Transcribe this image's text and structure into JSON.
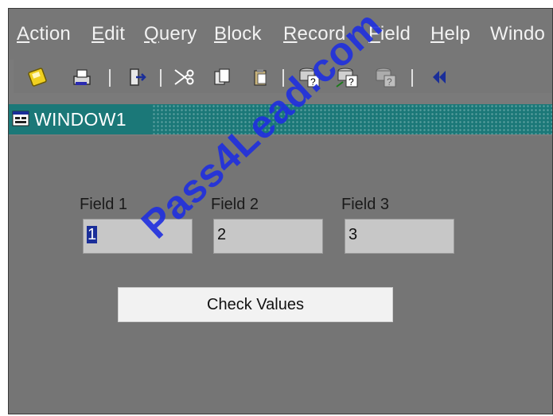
{
  "menu": {
    "items": [
      {
        "mnemonic": "A",
        "rest": "ction"
      },
      {
        "mnemonic": "E",
        "rest": "dit"
      },
      {
        "mnemonic": "Q",
        "rest": "uery"
      },
      {
        "mnemonic": "B",
        "rest": "lock"
      },
      {
        "mnemonic": "R",
        "rest": "ecord"
      },
      {
        "mnemonic": "F",
        "rest": "ield"
      },
      {
        "mnemonic": "H",
        "rest": "elp"
      },
      {
        "mnemonic": "W",
        "rest": "indo"
      }
    ]
  },
  "toolbar": {
    "icons": [
      "save-icon",
      "print-icon",
      "exit-icon",
      "cut-icon",
      "copy-icon",
      "paste-icon",
      "enter-query-icon",
      "execute-query-icon",
      "cancel-query-icon",
      "previous-block-icon"
    ]
  },
  "window": {
    "title": "WINDOW1"
  },
  "form": {
    "field1": {
      "label": "Field 1",
      "value": "1"
    },
    "field2": {
      "label": "Field 2",
      "value": "2"
    },
    "field3": {
      "label": "Field 3",
      "value": "3"
    },
    "button_label": "Check Values"
  },
  "watermark": "Pass4Lead.com",
  "colors": {
    "titlebar": "#1b7878",
    "selection": "#1a2e99",
    "watermark": "#1f2fe0"
  }
}
